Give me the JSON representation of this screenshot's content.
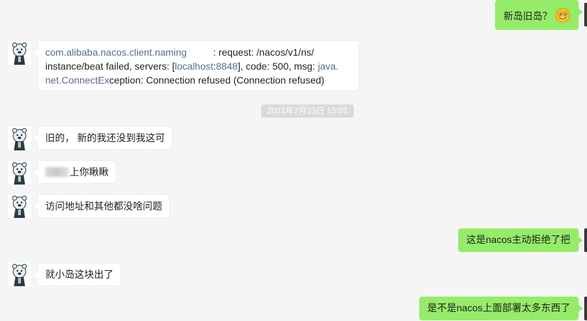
{
  "messages": [
    {
      "id": "m1",
      "side": "right",
      "text": "新岛旧岛？"
    },
    {
      "id": "m2",
      "side": "left",
      "parts": {
        "p1": "com.alibaba.nacos.client.naming",
        "p2": ": request: /nacos/v1/ns/",
        "p3": "instance/beat failed, servers: [",
        "p4": "localhost",
        "p5": ":",
        "p6": "8848",
        "p7": "], code: 500, msg: ",
        "p8": "java.",
        "p9": "net.ConnectEx",
        "p10": "ception: Connection refused (Connection refused)"
      }
    },
    {
      "id": "m3",
      "side": "left",
      "text": "旧的， 新的我还没到我这可"
    },
    {
      "id": "m4",
      "side": "left",
      "text": "上你瞅瞅"
    },
    {
      "id": "m5",
      "side": "left",
      "text": "访问地址和其他都没啥问题"
    },
    {
      "id": "m6",
      "side": "right",
      "text": "这是nacos主动拒绝了把"
    },
    {
      "id": "m7",
      "side": "left",
      "text": "就小岛这块出了"
    },
    {
      "id": "m8",
      "side": "right",
      "text": "是不是nacos上面部署太多东西了"
    }
  ],
  "timestamp": "2021年7月23日 15:01",
  "colors": {
    "outgoing_bubble": "#95ec69",
    "incoming_bubble": "#ffffff",
    "link": "#576b95",
    "background": "#f5f5f5"
  },
  "icons": {
    "contact_avatar": "cartoon-bear-avatar-icon",
    "emoji": "grinning-face-emoji-icon"
  }
}
